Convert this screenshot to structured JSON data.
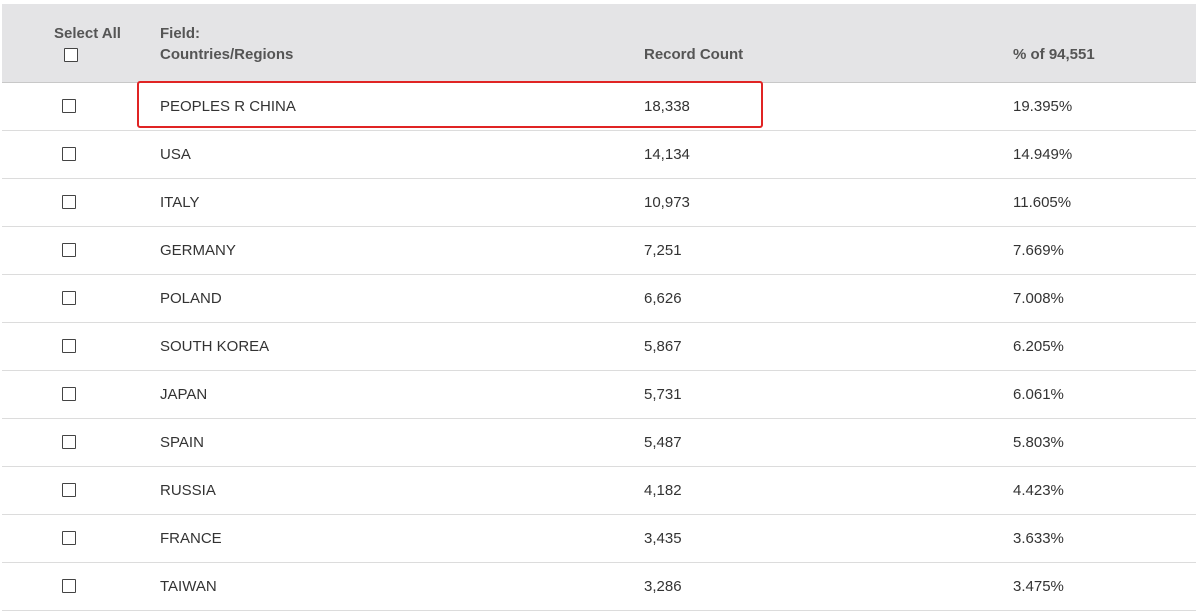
{
  "header": {
    "select_all": "Select All",
    "field_line1": "Field:",
    "field_line2": "Countries/Regions",
    "record_count": "Record Count",
    "percent": "% of 94,551"
  },
  "rows": [
    {
      "name": "PEOPLES R CHINA",
      "count": "18,338",
      "pct": "19.395%"
    },
    {
      "name": "USA",
      "count": "14,134",
      "pct": "14.949%"
    },
    {
      "name": "ITALY",
      "count": "10,973",
      "pct": "11.605%"
    },
    {
      "name": "GERMANY",
      "count": "7,251",
      "pct": "7.669%"
    },
    {
      "name": "POLAND",
      "count": "6,626",
      "pct": "7.008%"
    },
    {
      "name": "SOUTH KOREA",
      "count": "5,867",
      "pct": "6.205%"
    },
    {
      "name": "JAPAN",
      "count": "5,731",
      "pct": "6.061%"
    },
    {
      "name": "SPAIN",
      "count": "5,487",
      "pct": "5.803%"
    },
    {
      "name": "RUSSIA",
      "count": "4,182",
      "pct": "4.423%"
    },
    {
      "name": "FRANCE",
      "count": "3,435",
      "pct": "3.633%"
    },
    {
      "name": "TAIWAN",
      "count": "3,286",
      "pct": "3.475%"
    }
  ],
  "colors": {
    "header_bg": "#e4e4e6",
    "highlight": "#e02424"
  }
}
